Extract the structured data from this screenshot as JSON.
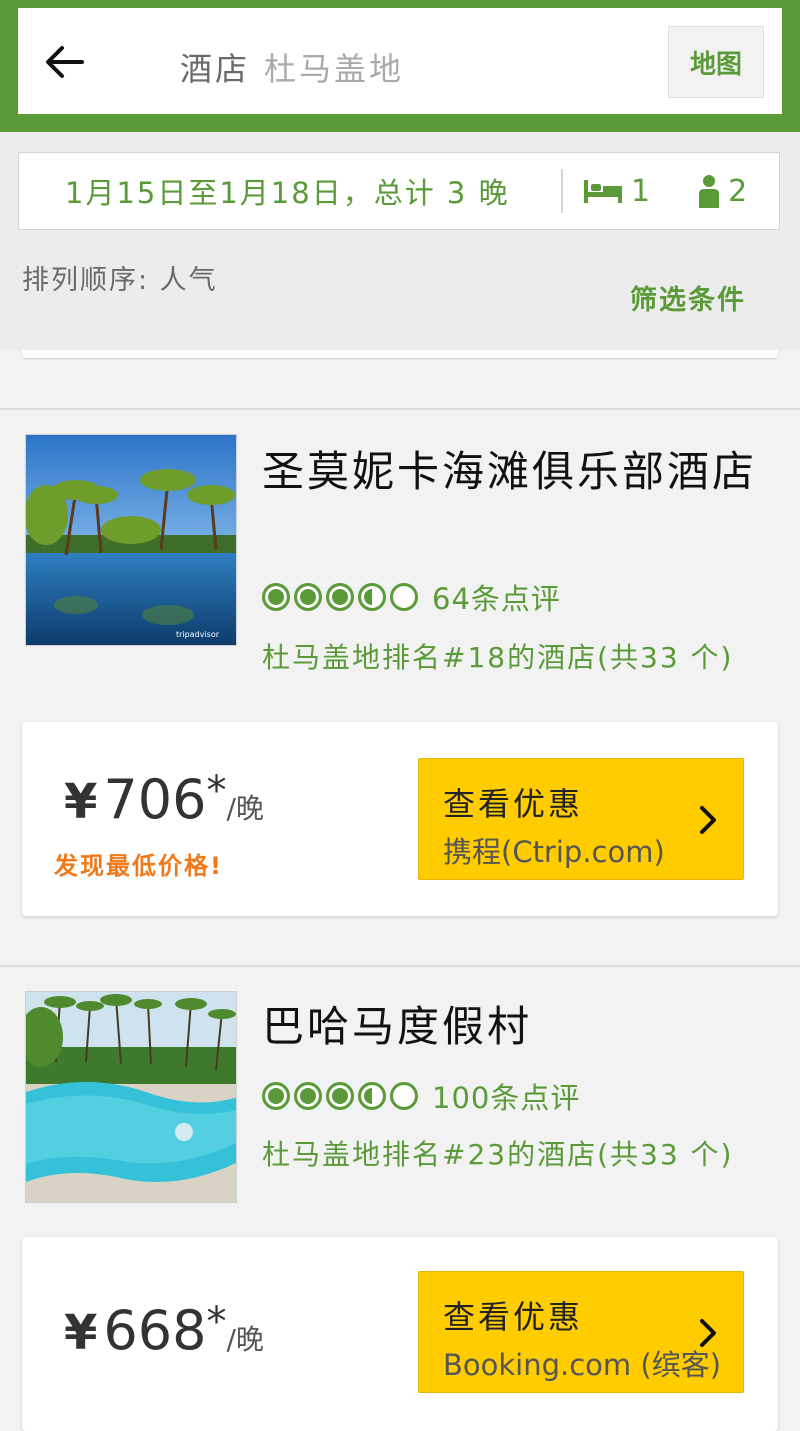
{
  "header": {
    "category": "酒店",
    "location": "杜马盖地",
    "map_label": "地图"
  },
  "filters": {
    "dates": "1月15日至1月18日，总计 3 晚",
    "rooms": "1",
    "guests": "2",
    "sort": "排列顺序: 人气",
    "filter_label": "筛选条件"
  },
  "hotels": [
    {
      "name": "圣莫妮卡海滩俱乐部酒店",
      "rating": 3.5,
      "reviews": "64条点评",
      "rank": "杜马盖地排名#18的酒店(共33 个)",
      "currency": "¥",
      "price": "706",
      "price_star": "*",
      "per_night": "/晚",
      "lowest_note": "发现最低价格!",
      "deal_title": "查看优惠",
      "deal_provider": "携程(Ctrip.com)"
    },
    {
      "name": "巴哈马度假村",
      "rating": 3.5,
      "reviews": "100条点评",
      "rank": "杜马盖地排名#23的酒店(共33 个)",
      "currency": "¥",
      "price": "668",
      "price_star": "*",
      "per_night": "/晚",
      "deal_title": "查看优惠",
      "deal_provider": "Booking.com (缤客)"
    }
  ],
  "colors": {
    "brand_green": "#5b9a38",
    "deal_yellow": "#ffcc00",
    "lowest_orange": "#f07a1a"
  },
  "icons": [
    "back-arrow-icon",
    "bed-icon",
    "person-icon",
    "rating-bubble-icon",
    "chevron-right-icon"
  ]
}
